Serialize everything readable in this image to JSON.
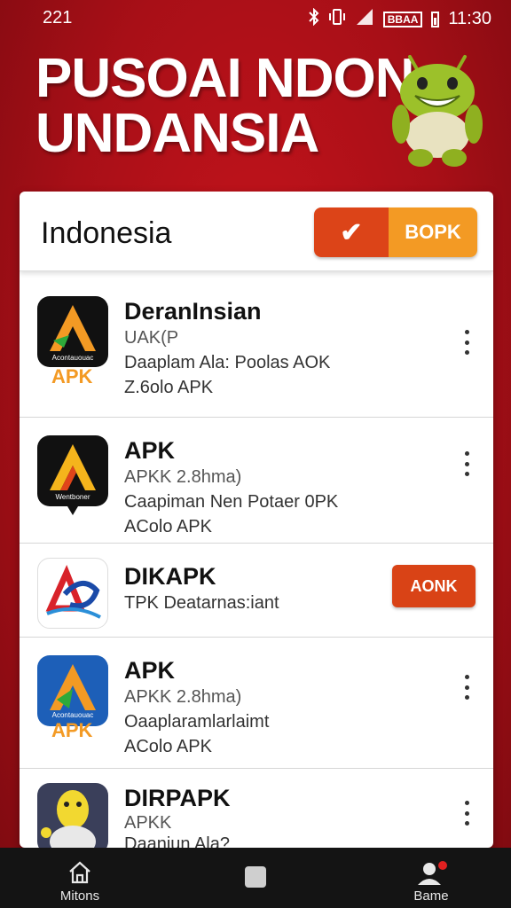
{
  "status_bar": {
    "left_time": "221",
    "right_time": "11:30",
    "battery_label": "BBAA",
    "icons": [
      "bluetooth-icon",
      "vibrate-icon",
      "signal-icon",
      "battery-icon"
    ]
  },
  "header": {
    "title_line1": "PUSOAI NDON",
    "title_line2": "UNDANSIA",
    "mascot": "android-robot"
  },
  "card": {
    "title": "Indonesia",
    "check_icon": "check-icon",
    "button_label": "BOPK"
  },
  "items": [
    {
      "title": "DeranInsian",
      "line1": "UAK(P",
      "line2": "Daaplam Ala: Poolas AOK",
      "line3": "Z.6olo APK",
      "icon_tag": "APK",
      "icon_text": "Acontauouac",
      "action": "kebab"
    },
    {
      "title": "APK",
      "line1": "APKK 2.8hma)",
      "line2": "Caapiman Nen Potaer 0PK",
      "line3": "AColo APK",
      "icon_text": "Wentboner",
      "action": "kebab"
    },
    {
      "title": "DIKAPK",
      "line1": "TPK Deatarnas:iant",
      "action": "button",
      "button_label": "AONK"
    },
    {
      "title": "APK",
      "line1": "APKK 2.8hma)",
      "line2": "Oaaplaramlarlaimt",
      "line3": "AColo APK",
      "icon_tag": "APK",
      "icon_text": "Acontauouac",
      "action": "kebab"
    },
    {
      "title": "DIRPAPK",
      "line1": "APKK",
      "line2": "Daaniun Ala?",
      "action": "kebab"
    }
  ],
  "bottom_nav": {
    "left_label": "Mitons",
    "right_label": "Bame",
    "left_icon": "home-icon",
    "center_icon": "square-icon",
    "right_icon": "profile-icon"
  },
  "colors": {
    "background": "#b8121a",
    "accent_orange": "#f39a24",
    "accent_red": "#dc4418",
    "nav_bg": "#141414"
  }
}
